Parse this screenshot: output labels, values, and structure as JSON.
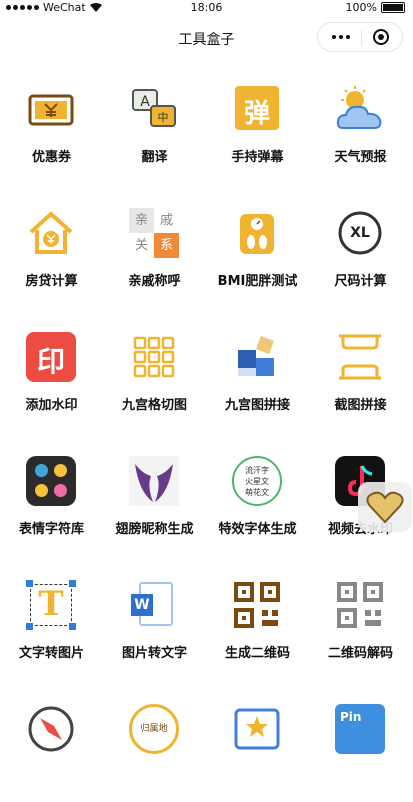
{
  "status": {
    "signal": "WeChat",
    "time": "18:06",
    "battery": "100%"
  },
  "navbar": {
    "title": "工具盒子"
  },
  "tools": [
    [
      {
        "label": "优惠券",
        "icon": "coupon-icon"
      },
      {
        "label": "翻译",
        "icon": "translate-icon"
      },
      {
        "label": "手持弹幕",
        "icon": "danmu-icon",
        "icon_text": "弹"
      },
      {
        "label": "天气预报",
        "icon": "weather-icon"
      }
    ],
    [
      {
        "label": "房贷计算",
        "icon": "house-loan-icon"
      },
      {
        "label": "亲戚称呼",
        "icon": "relatives-icon",
        "icon_text": [
          "亲",
          "戚",
          "关",
          "系"
        ]
      },
      {
        "label": "BMI肥胖测试",
        "icon": "bmi-scale-icon"
      },
      {
        "label": "尺码计算",
        "icon": "size-icon",
        "icon_text": "XL"
      }
    ],
    [
      {
        "label": "添加水印",
        "icon": "watermark-icon",
        "icon_text": "印"
      },
      {
        "label": "九宫格切图",
        "icon": "nine-grid-icon"
      },
      {
        "label": "九宫图拼接",
        "icon": "puzzle-icon"
      },
      {
        "label": "截图拼接",
        "icon": "screenshot-join-icon"
      }
    ],
    [
      {
        "label": "表情字符库",
        "icon": "emoji-icon"
      },
      {
        "label": "翅膀昵称生成",
        "icon": "wings-icon"
      },
      {
        "label": "特效字体生成",
        "icon": "fancy-font-icon",
        "icon_text": [
          "流汗字",
          "火星文",
          "萌花文"
        ]
      },
      {
        "label": "视频去水印",
        "icon": "video-watermark-icon"
      }
    ],
    [
      {
        "label": "文字转图片",
        "icon": "text-to-image-icon",
        "icon_text": "T"
      },
      {
        "label": "图片转文字",
        "icon": "image-to-text-icon",
        "icon_text": "W"
      },
      {
        "label": "生成二维码",
        "icon": "qr-generate-icon"
      },
      {
        "label": "二维码解码",
        "icon": "qr-decode-icon"
      }
    ],
    [
      {
        "label": "",
        "icon": "compass-icon"
      },
      {
        "label": "",
        "icon": "location-icon",
        "icon_text": "归属地"
      },
      {
        "label": "",
        "icon": "star-app-icon"
      },
      {
        "label": "",
        "icon": "pinyin-icon",
        "icon_text": "Pin"
      }
    ]
  ],
  "colors": {
    "orange": "#f0b431",
    "brown": "#7a4a10",
    "red": "#ec4c42",
    "blue": "#3f7fd8"
  }
}
